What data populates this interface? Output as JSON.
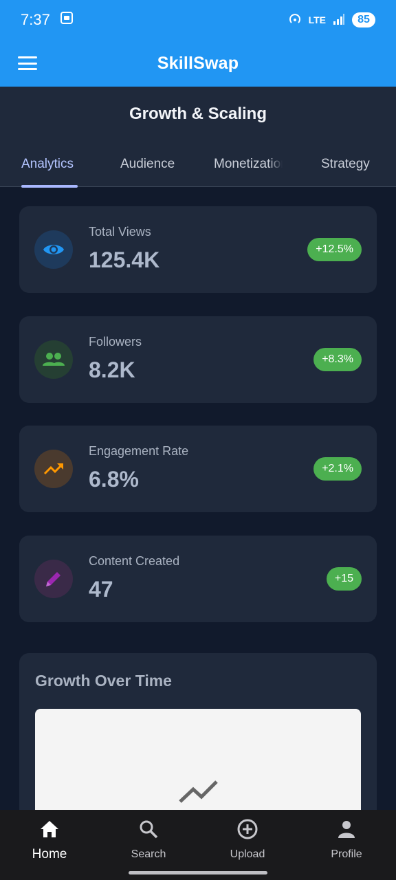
{
  "status_bar": {
    "time": "7:37",
    "network": "LTE",
    "battery": "85"
  },
  "app_bar": {
    "title": "SkillSwap"
  },
  "header": {
    "title": "Growth & Scaling"
  },
  "tabs": [
    {
      "label": "Analytics",
      "active": true
    },
    {
      "label": "Audience",
      "active": false
    },
    {
      "label": "Monetization",
      "active": false
    },
    {
      "label": "Strategy",
      "active": false
    }
  ],
  "stats": [
    {
      "label": "Total Views",
      "value": "125.4K",
      "change": "+12.5%",
      "icon": "eye-icon",
      "color": "#2196f3"
    },
    {
      "label": "Followers",
      "value": "8.2K",
      "change": "+8.3%",
      "icon": "people-icon",
      "color": "#4caf50"
    },
    {
      "label": "Engagement Rate",
      "value": "6.8%",
      "change": "+2.1%",
      "icon": "trending-up-icon",
      "color": "#ff9800"
    },
    {
      "label": "Content Created",
      "value": "47",
      "change": "+15",
      "icon": "pencil-icon",
      "color": "#9c27b0"
    }
  ],
  "growth": {
    "title": "Growth Over Time"
  },
  "bottom_nav": [
    {
      "label": "Home",
      "icon": "home-icon",
      "active": true
    },
    {
      "label": "Search",
      "icon": "search-icon",
      "active": false
    },
    {
      "label": "Upload",
      "icon": "add-circle-icon",
      "active": false
    },
    {
      "label": "Profile",
      "icon": "person-icon",
      "active": false
    }
  ],
  "colors": {
    "primary": "#2196f3",
    "badge": "#4caf50",
    "tab_active": "#b3c4ff"
  }
}
